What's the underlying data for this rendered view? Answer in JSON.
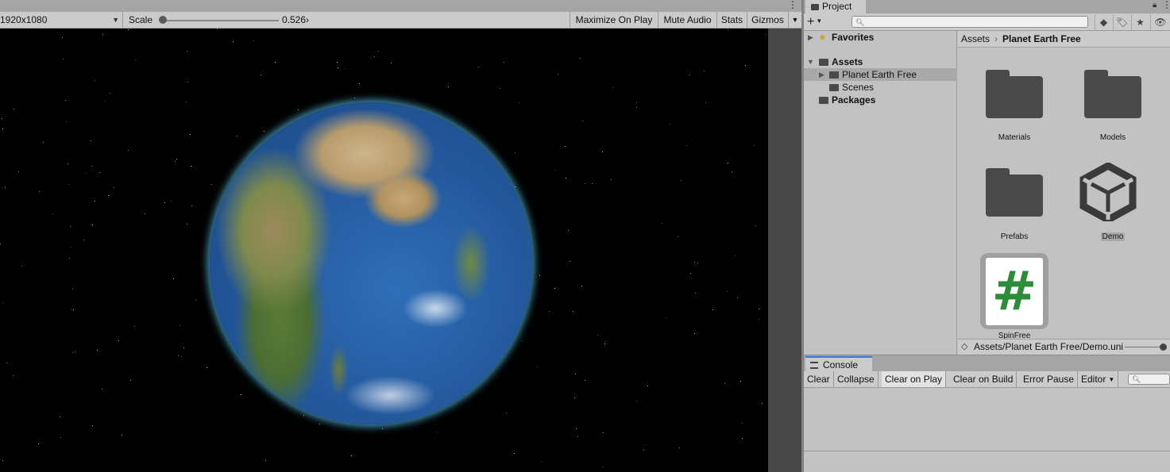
{
  "game_view": {
    "resolution": "1920x1080",
    "scale_label": "Scale",
    "scale_value": "0.526›",
    "scale_fraction": 0.05,
    "buttons": {
      "maximize_on_play": "Maximize On Play",
      "mute_audio": "Mute Audio",
      "stats": "Stats",
      "gizmos": "Gizmos"
    },
    "menu_icon": "kebab-menu-icon"
  },
  "project": {
    "tab_label": "Project",
    "search_placeholder": "",
    "toolbar_icons": [
      "create-plus-icon",
      "search-by-type-icon",
      "search-by-label-icon",
      "favorite-star-icon",
      "hidden-packages-icon"
    ],
    "tree": {
      "favorites": "Favorites",
      "assets": "Assets",
      "planet_earth_free": "Planet Earth Free",
      "scenes": "Scenes",
      "packages": "Packages"
    },
    "breadcrumb": {
      "root": "Assets",
      "current": "Planet Earth Free"
    },
    "assets": [
      {
        "name": "Materials",
        "kind": "folder"
      },
      {
        "name": "Models",
        "kind": "folder"
      },
      {
        "name": "Prefabs",
        "kind": "folder"
      },
      {
        "name": "Demo",
        "kind": "unity-scene"
      },
      {
        "name": "SpinFree",
        "kind": "csharp-script",
        "glyph": "#"
      }
    ],
    "path": "Assets/Planet Earth Free/Demo.unity"
  },
  "console": {
    "tab_label": "Console",
    "buttons": {
      "clear": "Clear",
      "collapse": "Collapse",
      "clear_on_play": "Clear on Play",
      "clear_on_build": "Clear on Build",
      "error_pause": "Error Pause",
      "editor": "Editor"
    },
    "active_toggles": [
      "Clear on Play"
    ]
  },
  "colors": {
    "selection": "#3a79d7",
    "script_green": "#2e8b3a",
    "earth_glow": "#7fd3f2"
  }
}
